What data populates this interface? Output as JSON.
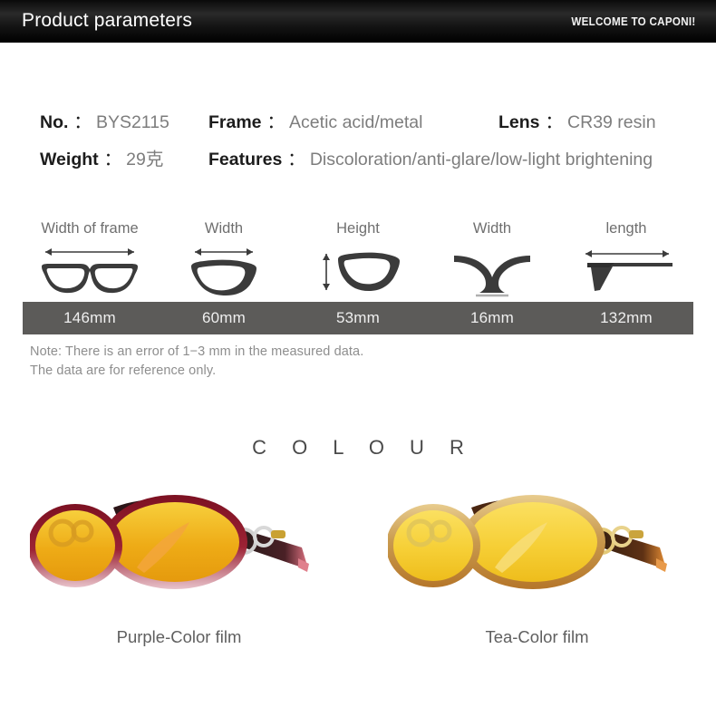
{
  "header": {
    "title": "Product parameters",
    "welcome": "WELCOME TO CAPONI!"
  },
  "specs": {
    "colon": "：",
    "rows": [
      [
        {
          "label": "No.",
          "value": "BYS2115"
        },
        {
          "label": "Frame",
          "value": "Acetic acid/metal"
        },
        {
          "label": "Lens",
          "value": "CR39 resin"
        }
      ],
      [
        {
          "label": "Weight",
          "value": "29克"
        },
        {
          "label": "Features",
          "value": "Discoloration/anti-glare/low-light brightening"
        }
      ]
    ]
  },
  "measurements": {
    "columns": [
      {
        "label": "Width of frame",
        "value": "146mm",
        "icon": "frame-width-icon"
      },
      {
        "label": "Width",
        "value": "60mm",
        "icon": "lens-width-icon"
      },
      {
        "label": "Height",
        "value": "53mm",
        "icon": "lens-height-icon"
      },
      {
        "label": "Width",
        "value": "16mm",
        "icon": "bridge-width-icon"
      },
      {
        "label": "length",
        "value": "132mm",
        "icon": "temple-length-icon"
      }
    ],
    "bar_color": "#5c5b59"
  },
  "note": {
    "line1": "Note: There is an error of 1−3 mm in the measured data.",
    "line2": "The data are for reference only."
  },
  "colour": {
    "title": "C O L O U R",
    "items": [
      {
        "caption": "Purple-Color film",
        "frame_color": "#8c1b2d",
        "lens_color": "#f0b515"
      },
      {
        "caption": "Tea-Color film",
        "frame_color": "#7a3a14",
        "lens_color": "#f5d03c"
      }
    ]
  }
}
